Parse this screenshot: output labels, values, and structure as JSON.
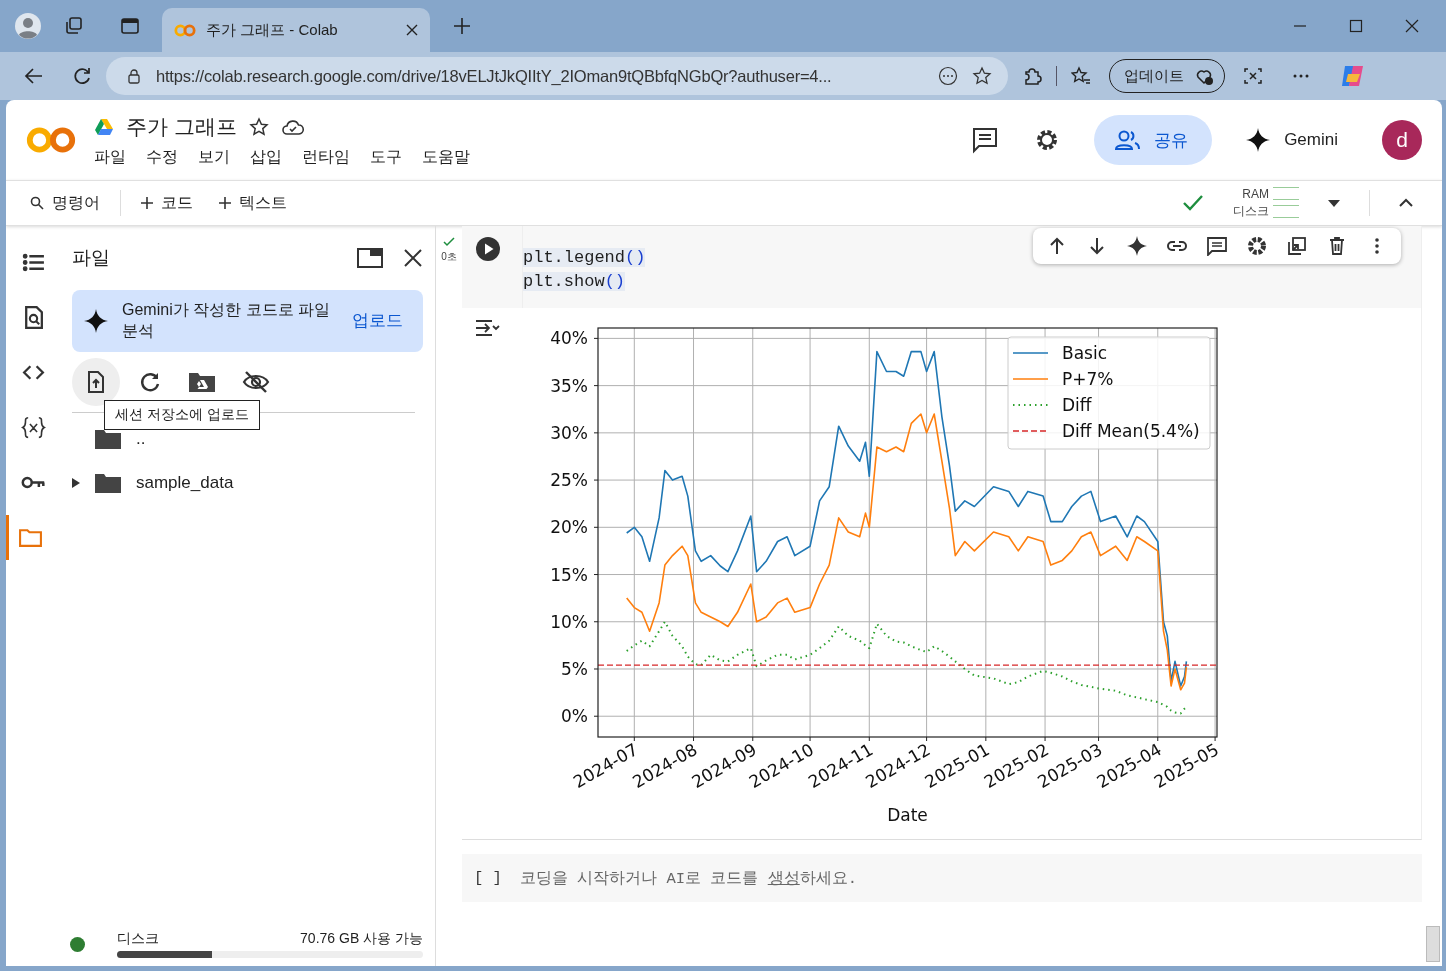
{
  "browser": {
    "tab": {
      "title": "주가 그래프 - Colab",
      "selected": true
    },
    "address": "https://colab.research.google.com/drive/18vELJtJkQIItY_2IOman9tQBbfqNGbQr?authuser=4...",
    "update_button": "업데이트"
  },
  "header": {
    "title": "주가 그래프",
    "menu": [
      "파일",
      "수정",
      "보기",
      "삽입",
      "런타임",
      "도구",
      "도움말"
    ],
    "share_button": "공유",
    "gemini_button": "Gemini",
    "avatar": "d"
  },
  "toolbar": {
    "command": "명령어",
    "add_code": "코드",
    "add_text": "텍스트",
    "ram_label": "RAM",
    "disk_label": "디스크"
  },
  "rail": [
    {
      "kind": "toc",
      "selected": false
    },
    {
      "kind": "find",
      "selected": false
    },
    {
      "kind": "snippets",
      "selected": false
    },
    {
      "kind": "variables",
      "selected": false
    },
    {
      "kind": "secrets",
      "selected": false
    },
    {
      "kind": "files",
      "selected": true
    }
  ],
  "sidebar": {
    "title": "파일",
    "banner": {
      "text": "Gemini가 작성한 코드로 파일 분석",
      "action": "업로드"
    },
    "tooltip": "세션 저장소에 업로드",
    "tree": [
      {
        "name": "..",
        "kind": "parent"
      },
      {
        "name": "sample_data",
        "kind": "folder",
        "expanded": false
      }
    ],
    "disk": {
      "label": "디스크",
      "available": "70.76 GB 사용 가능",
      "level": 0.31
    }
  },
  "cell": {
    "status": "0초",
    "code": [
      "plt.legend()",
      "plt.show()"
    ],
    "chart_data": {
      "type": "line",
      "xlabel": "Date",
      "xlim": [
        "2024-06-12",
        "2025-05-02"
      ],
      "ylim": [
        -2.2,
        41.1
      ],
      "xticks": [
        {
          "value": "2024-07-01",
          "label": "2024-07"
        },
        {
          "value": "2024-08-01",
          "label": "2024-08"
        },
        {
          "value": "2024-09-01",
          "label": "2024-09"
        },
        {
          "value": "2024-10-01",
          "label": "2024-10"
        },
        {
          "value": "2024-11-01",
          "label": "2024-11"
        },
        {
          "value": "2024-12-01",
          "label": "2024-12"
        },
        {
          "value": "2025-01-01",
          "label": "2025-01"
        },
        {
          "value": "2025-02-01",
          "label": "2025-02"
        },
        {
          "value": "2025-03-01",
          "label": "2025-03"
        },
        {
          "value": "2025-04-01",
          "label": "2025-04"
        },
        {
          "value": "2025-05-01",
          "label": "2025-05"
        }
      ],
      "yticks": [
        {
          "value": 0,
          "label": "0%"
        },
        {
          "value": 5,
          "label": "5%"
        },
        {
          "value": 10,
          "label": "10%"
        },
        {
          "value": 15,
          "label": "15%"
        },
        {
          "value": 20,
          "label": "20%"
        },
        {
          "value": 25,
          "label": "25%"
        },
        {
          "value": 30,
          "label": "30%"
        },
        {
          "value": 35,
          "label": "35%"
        },
        {
          "value": 40,
          "label": "40%"
        }
      ],
      "x": [
        "2024-06-27",
        "2024-07-01",
        "2024-07-05",
        "2024-07-09",
        "2024-07-14",
        "2024-07-17",
        "2024-07-21",
        "2024-07-26",
        "2024-07-29",
        "2024-08-02",
        "2024-08-05",
        "2024-08-10",
        "2024-08-15",
        "2024-08-19",
        "2024-08-24",
        "2024-08-31",
        "2024-09-03",
        "2024-09-08",
        "2024-09-14",
        "2024-09-19",
        "2024-09-23",
        "2024-10-01",
        "2024-10-06",
        "2024-10-11",
        "2024-10-16",
        "2024-10-21",
        "2024-10-27",
        "2024-10-30",
        "2024-11-01",
        "2024-11-05",
        "2024-11-10",
        "2024-11-15",
        "2024-11-19",
        "2024-11-23",
        "2024-11-28",
        "2024-12-01",
        "2024-12-05",
        "2024-12-09",
        "2024-12-13",
        "2024-12-16",
        "2024-12-21",
        "2024-12-26",
        "2025-01-05",
        "2025-01-13",
        "2025-01-18",
        "2025-01-23",
        "2025-01-31",
        "2025-02-04",
        "2025-02-10",
        "2025-02-15",
        "2025-02-20",
        "2025-02-25",
        "2025-03-02",
        "2025-03-10",
        "2025-03-16",
        "2025-03-21",
        "2025-03-25",
        "2025-04-01",
        "2025-04-04",
        "2025-04-06",
        "2025-04-08",
        "2025-04-10",
        "2025-04-13",
        "2025-04-15",
        "2025-04-16"
      ],
      "series": [
        {
          "name": "Basic",
          "color": "#1f77b4",
          "line_style": "solid",
          "values": [
            19.4,
            20,
            19,
            16.4,
            21,
            26,
            25,
            25.4,
            23.3,
            17.5,
            16.4,
            17,
            15.9,
            15.3,
            17.5,
            21.2,
            15.3,
            16.4,
            18.5,
            19,
            17,
            18,
            22.8,
            24.3,
            30.7,
            28.6,
            27,
            29,
            25.4,
            38.6,
            36.5,
            36.5,
            36,
            38.6,
            38.6,
            36.5,
            38.6,
            31.7,
            26.5,
            21.7,
            22.8,
            22.2,
            24.3,
            23.8,
            22.2,
            23.8,
            23.3,
            20.6,
            20.6,
            22.2,
            23.3,
            23.8,
            20.6,
            21.2,
            19,
            21.2,
            20.6,
            18.5,
            10,
            8.5,
            3.7,
            5.8,
            3.2,
            4.2,
            5.8
          ]
        },
        {
          "name": "P+7%",
          "color": "#ff7f0e",
          "line_style": "solid",
          "values": [
            12.5,
            11.5,
            11,
            9,
            12,
            16,
            17,
            18,
            17,
            12,
            11,
            10.5,
            10,
            9.5,
            11,
            14,
            10,
            10.5,
            12,
            12.5,
            11,
            11.5,
            14,
            16,
            21,
            19.5,
            19,
            21.5,
            20,
            28.5,
            28,
            28.5,
            28,
            31,
            32,
            30,
            32,
            27,
            22,
            17,
            18.5,
            17.5,
            19.5,
            19,
            17.5,
            19,
            18.5,
            16,
            16.5,
            17.5,
            19,
            19.5,
            17,
            18,
            16.5,
            19,
            18.5,
            17.5,
            9,
            7,
            3.2,
            5,
            2.8,
            3.5,
            5.2
          ]
        },
        {
          "name": "Diff",
          "color": "#2ca02c",
          "line_style": "dotted",
          "values": [
            6.9,
            7.5,
            8,
            7.4,
            9,
            10,
            8.5,
            7.4,
            6.3,
            5.5,
            5.4,
            6.5,
            5.9,
            5.8,
            6.5,
            7.2,
            5.3,
            5.9,
            6.5,
            6.5,
            6,
            6.5,
            7.2,
            8,
            9.5,
            8.5,
            8,
            7.5,
            7.2,
            9.8,
            8.5,
            7.9,
            7.8,
            7.4,
            7,
            6.8,
            7.4,
            6.9,
            6.3,
            5.8,
            5,
            4.3,
            4,
            3.4,
            3.6,
            4.2,
            4.8,
            4.6,
            4.2,
            3.7,
            3.3,
            3.1,
            2.9,
            2.7,
            2.2,
            2,
            1.8,
            1.5,
            1.2,
            1,
            0.6,
            0.4,
            0.3,
            0.8,
            1
          ]
        }
      ],
      "ref_lines": [
        {
          "axis": "y",
          "value": 5.4,
          "label": "Diff Mean(5.4%)",
          "color": "#d62728"
        }
      ],
      "grid": true,
      "legend": true
    }
  },
  "empty_cell": {
    "brackets": "[ ]",
    "text_before": "코딩을 시작하거나 AI로 코드를 ",
    "link": "생성",
    "text_after": "하세요."
  }
}
